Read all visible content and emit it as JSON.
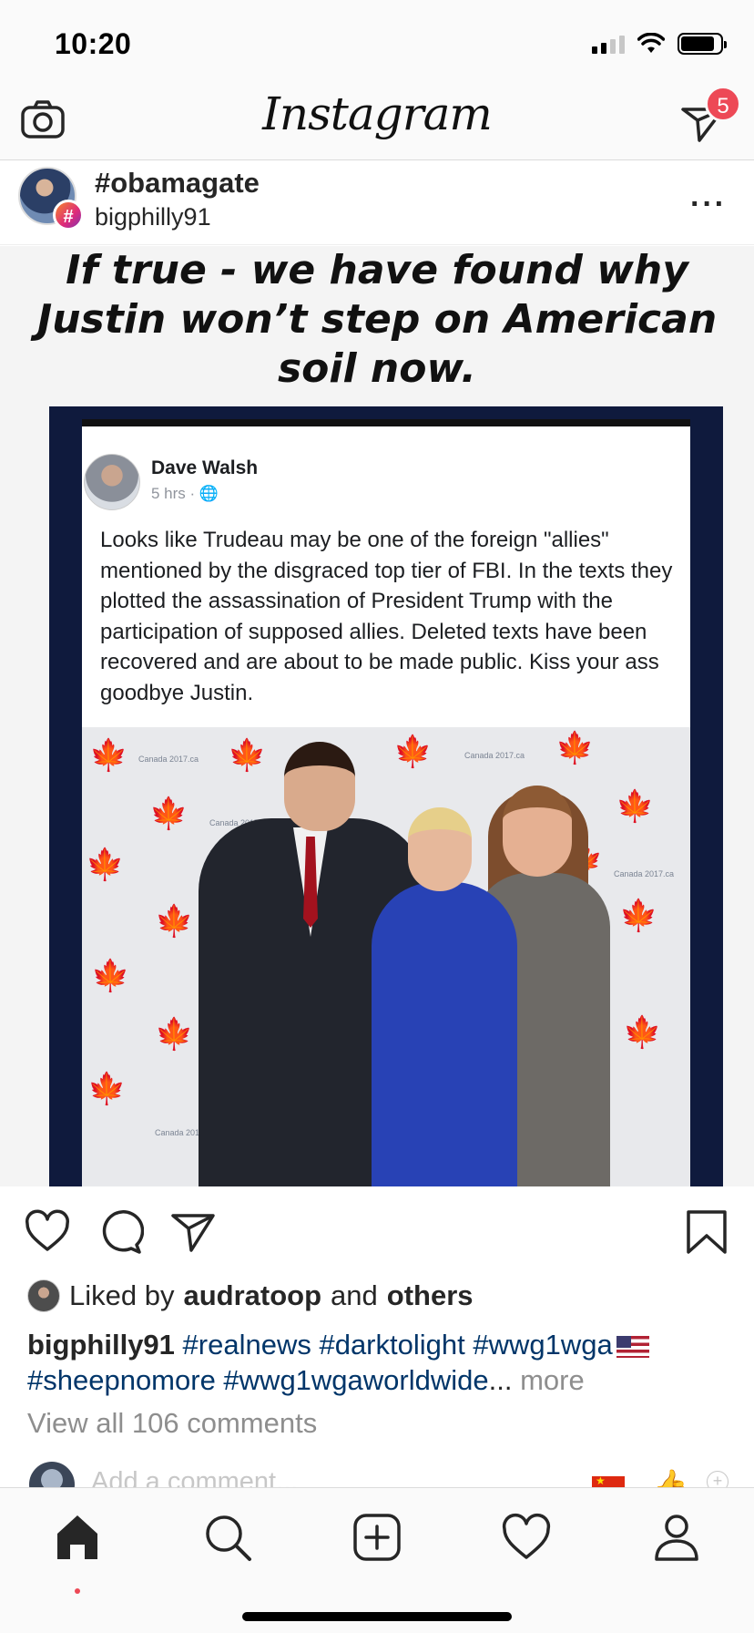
{
  "status_bar": {
    "time": "10:20"
  },
  "header": {
    "logo": "Instagram",
    "direct_badge_count": "5",
    "icons": [
      "camera-icon",
      "direct-message-icon"
    ]
  },
  "post": {
    "hashtag": "#obamagate",
    "username": "bigphilly91",
    "hashtag_badge": "#",
    "more_label": "···",
    "image": {
      "headline": "If true - we have found why Justin won’t step on American soil now.",
      "facebook_post": {
        "author": "Dave Walsh",
        "meta": "5 hrs · 🌐",
        "text": "Looks like Trudeau may be one of the foreign \"allies\" mentioned by the disgraced top tier of FBI. In the texts they plotted the assassination of President Trump with the participation of supposed allies.  Deleted texts have been recovered and are about to be made public. Kiss your ass goodbye Justin.",
        "backdrop_label": "Canada 2017.ca"
      }
    },
    "actions": [
      "heart-icon",
      "comment-icon",
      "share-icon",
      "bookmark-icon"
    ],
    "likes": {
      "prefix": "Liked by",
      "user": "audratoop",
      "and": "and",
      "others": "others"
    },
    "caption": {
      "user": "bigphilly91",
      "tags_line1": "#realnews #darktolight #wwg1wga",
      "tags_line2": "#sheepnomore #wwg1wgaworldwide",
      "ellipsis": "...",
      "more": "more"
    },
    "view_comments": "View all 106 comments",
    "add_comment_placeholder": "Add a comment..."
  },
  "tabs": [
    "home-tab",
    "search-tab",
    "new-post-tab",
    "activity-tab",
    "profile-tab"
  ],
  "colors": {
    "badge": "#ed4956",
    "hashtag": "#003569",
    "muted": "#8e8e8e",
    "frame": "#0f1a3d"
  }
}
